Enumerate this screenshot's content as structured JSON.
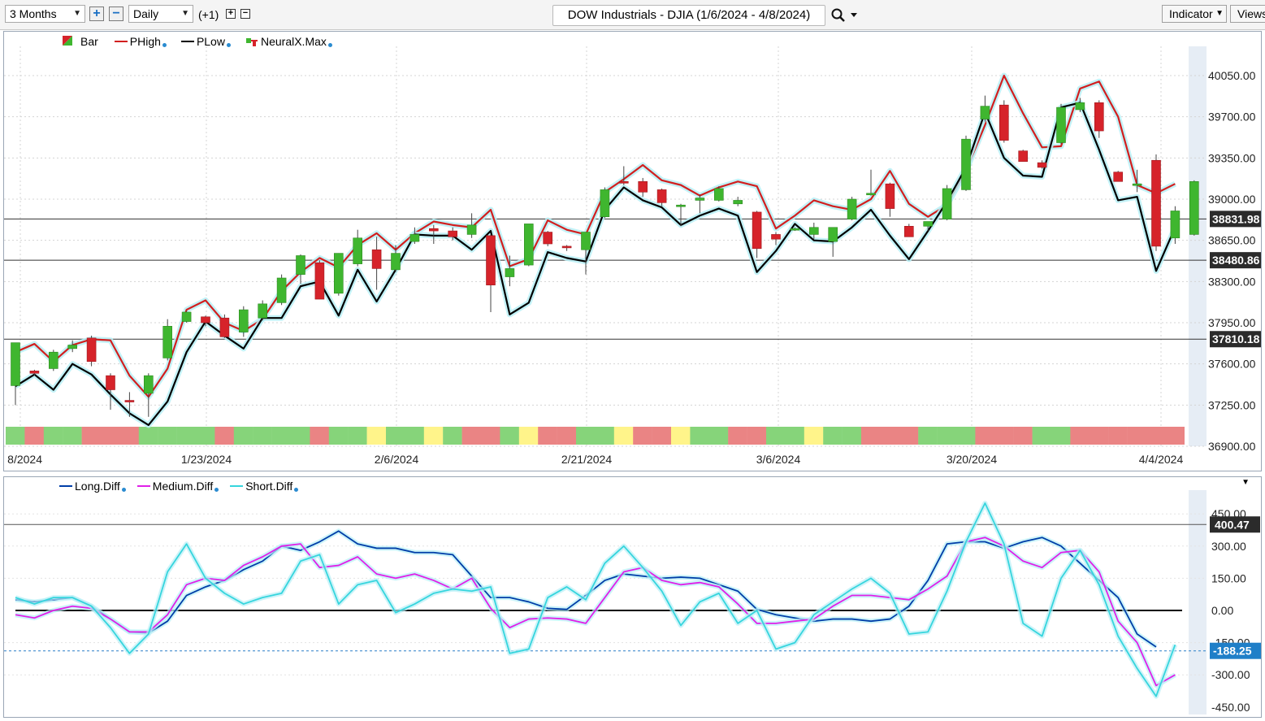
{
  "toolbar": {
    "range": "3 Months",
    "interval": "Daily",
    "offset": "(+1)",
    "title": "DOW Industrials - DJIA (1/6/2024 - 4/8/2024)",
    "indicator_btn": "Indicator",
    "views_btn": "Views"
  },
  "colors": {
    "up": "#3fb62f",
    "down": "#d6232a",
    "phigh": "#d21f1f",
    "plow": "#000000",
    "glow": "#b8f0f6",
    "long": "#003ea8",
    "medium": "#e020e8",
    "short": "#36d5dd"
  },
  "legend_top": [
    {
      "label": "Bar",
      "icon": "candle-icon"
    },
    {
      "label": "PHigh",
      "icon": "line-red-icon"
    },
    {
      "label": "PLow",
      "icon": "line-black-icon"
    },
    {
      "label": "NeuralX.Max",
      "icon": "bar-icon"
    }
  ],
  "legend_bottom": [
    {
      "label": "Long.Diff",
      "color": "#003ea8"
    },
    {
      "label": "Medium.Diff",
      "color": "#e020e8"
    },
    {
      "label": "Short.Diff",
      "color": "#36d5dd"
    }
  ],
  "chart_data": [
    {
      "type": "candlestick",
      "title": "DOW Industrials - DJIA (1/6/2024 - 4/8/2024)",
      "x_tick_labels": [
        "8/2024",
        "1/23/2024",
        "2/6/2024",
        "2/21/2024",
        "3/6/2024",
        "3/20/2024",
        "4/4/2024"
      ],
      "y_tick_labels": [
        "40050.00",
        "39700.00",
        "39350.00",
        "39000.00",
        "38650.00",
        "38300.00",
        "37950.00",
        "37600.00",
        "37250.00",
        "36900.00"
      ],
      "ylim": [
        36900,
        40350
      ],
      "hlines": [
        {
          "value": 38831.98,
          "label": "38831.98"
        },
        {
          "value": 38480.86,
          "label": "38480.86"
        },
        {
          "value": 37810.18,
          "label": "37810.18"
        }
      ],
      "candles": [
        {
          "o": 37415,
          "h": 37740,
          "l": 37250,
          "c": 37780
        },
        {
          "o": 37540,
          "h": 37550,
          "l": 37500,
          "c": 37520
        },
        {
          "o": 37560,
          "h": 37720,
          "l": 37540,
          "c": 37700
        },
        {
          "o": 37730,
          "h": 37800,
          "l": 37700,
          "c": 37760
        },
        {
          "o": 37820,
          "h": 37840,
          "l": 37580,
          "c": 37620
        },
        {
          "o": 37500,
          "h": 37520,
          "l": 37210,
          "c": 37380
        },
        {
          "o": 37290,
          "h": 37360,
          "l": 37150,
          "c": 37280
        },
        {
          "o": 37350,
          "h": 37520,
          "l": 37150,
          "c": 37500
        },
        {
          "o": 37650,
          "h": 37980,
          "l": 37630,
          "c": 37920
        },
        {
          "o": 37960,
          "h": 38050,
          "l": 37950,
          "c": 38040
        },
        {
          "o": 38000,
          "h": 38010,
          "l": 37920,
          "c": 37950
        },
        {
          "o": 37990,
          "h": 38020,
          "l": 37820,
          "c": 37830
        },
        {
          "o": 37870,
          "h": 38090,
          "l": 37830,
          "c": 38060
        },
        {
          "o": 37990,
          "h": 38140,
          "l": 37970,
          "c": 38110
        },
        {
          "o": 38120,
          "h": 38360,
          "l": 38100,
          "c": 38330
        },
        {
          "o": 38360,
          "h": 38530,
          "l": 38280,
          "c": 38520
        },
        {
          "o": 38460,
          "h": 38480,
          "l": 38150,
          "c": 38150
        },
        {
          "o": 38200,
          "h": 38540,
          "l": 38180,
          "c": 38540
        },
        {
          "o": 38450,
          "h": 38740,
          "l": 38430,
          "c": 38670
        },
        {
          "o": 38570,
          "h": 38680,
          "l": 38230,
          "c": 38410
        },
        {
          "o": 38400,
          "h": 38610,
          "l": 38380,
          "c": 38540
        },
        {
          "o": 38640,
          "h": 38760,
          "l": 38620,
          "c": 38700
        },
        {
          "o": 38750,
          "h": 38780,
          "l": 38620,
          "c": 38730
        },
        {
          "o": 38730,
          "h": 38760,
          "l": 38650,
          "c": 38680
        },
        {
          "o": 38700,
          "h": 38880,
          "l": 38670,
          "c": 38780
        },
        {
          "o": 38690,
          "h": 38700,
          "l": 38040,
          "c": 38270
        },
        {
          "o": 38340,
          "h": 38520,
          "l": 38260,
          "c": 38410
        },
        {
          "o": 38440,
          "h": 38780,
          "l": 38430,
          "c": 38790
        },
        {
          "o": 38720,
          "h": 38730,
          "l": 38600,
          "c": 38620
        },
        {
          "o": 38600,
          "h": 38610,
          "l": 38560,
          "c": 38590
        },
        {
          "o": 38570,
          "h": 38710,
          "l": 38360,
          "c": 38720
        },
        {
          "o": 38850,
          "h": 39100,
          "l": 38840,
          "c": 39080
        },
        {
          "o": 39150,
          "h": 39280,
          "l": 39120,
          "c": 39140
        },
        {
          "o": 39150,
          "h": 39180,
          "l": 39020,
          "c": 39060
        },
        {
          "o": 39080,
          "h": 39090,
          "l": 38940,
          "c": 38970
        },
        {
          "o": 38950,
          "h": 38960,
          "l": 38770,
          "c": 38950
        },
        {
          "o": 38990,
          "h": 39040,
          "l": 38880,
          "c": 39010
        },
        {
          "o": 38990,
          "h": 39110,
          "l": 38980,
          "c": 39090
        },
        {
          "o": 38960,
          "h": 39020,
          "l": 38940,
          "c": 38990
        },
        {
          "o": 38890,
          "h": 38900,
          "l": 38500,
          "c": 38580
        },
        {
          "o": 38700,
          "h": 38720,
          "l": 38610,
          "c": 38660
        },
        {
          "o": 38750,
          "h": 38760,
          "l": 38730,
          "c": 38750
        },
        {
          "o": 38700,
          "h": 38800,
          "l": 38660,
          "c": 38760
        },
        {
          "o": 38640,
          "h": 38760,
          "l": 38510,
          "c": 38760
        },
        {
          "o": 38830,
          "h": 39020,
          "l": 38820,
          "c": 39000
        },
        {
          "o": 39050,
          "h": 39250,
          "l": 39030,
          "c": 39050
        },
        {
          "o": 39130,
          "h": 39140,
          "l": 38850,
          "c": 38920
        },
        {
          "o": 38770,
          "h": 38790,
          "l": 38680,
          "c": 38680
        },
        {
          "o": 38770,
          "h": 38810,
          "l": 38730,
          "c": 38810
        },
        {
          "o": 38830,
          "h": 39120,
          "l": 38820,
          "c": 39090
        },
        {
          "o": 39080,
          "h": 39540,
          "l": 39070,
          "c": 39510
        },
        {
          "o": 39680,
          "h": 39880,
          "l": 39660,
          "c": 39790
        },
        {
          "o": 39800,
          "h": 39840,
          "l": 39480,
          "c": 39500
        },
        {
          "o": 39410,
          "h": 39420,
          "l": 39320,
          "c": 39320
        },
        {
          "o": 39310,
          "h": 39330,
          "l": 39260,
          "c": 39270
        },
        {
          "o": 39480,
          "h": 39810,
          "l": 39470,
          "c": 39780
        },
        {
          "o": 39760,
          "h": 39860,
          "l": 39740,
          "c": 39820
        },
        {
          "o": 39820,
          "h": 39840,
          "l": 39520,
          "c": 39580
        },
        {
          "o": 39230,
          "h": 39240,
          "l": 39150,
          "c": 39150
        },
        {
          "o": 39130,
          "h": 39250,
          "l": 39060,
          "c": 39130
        },
        {
          "o": 39330,
          "h": 39380,
          "l": 38560,
          "c": 38600
        },
        {
          "o": 38670,
          "h": 38940,
          "l": 38620,
          "c": 38900
        },
        {
          "o": 38700,
          "h": 39160,
          "l": 38690,
          "c": 39150
        }
      ],
      "phigh": [
        37700,
        37770,
        37620,
        37760,
        37810,
        37800,
        37500,
        37320,
        37560,
        38060,
        38140,
        37950,
        37880,
        37980,
        38220,
        38380,
        38500,
        38420,
        38610,
        38710,
        38570,
        38710,
        38810,
        38780,
        38760,
        38910,
        38430,
        38490,
        38820,
        38740,
        38700,
        39060,
        39170,
        39290,
        39160,
        39120,
        39030,
        39100,
        39150,
        39110,
        38750,
        38860,
        38990,
        38940,
        38910,
        39000,
        39240,
        38960,
        38850,
        38950,
        39240,
        39630,
        40050,
        39730,
        39440,
        39450,
        39940,
        40000,
        39700,
        39120,
        39050,
        39130
      ],
      "plow": [
        37410,
        37510,
        37380,
        37600,
        37510,
        37340,
        37180,
        37080,
        37280,
        37700,
        37960,
        37840,
        37730,
        37990,
        37990,
        38260,
        38300,
        38010,
        38400,
        38130,
        38400,
        38700,
        38690,
        38690,
        38570,
        38730,
        38020,
        38120,
        38550,
        38500,
        38470,
        38910,
        39100,
        38990,
        38930,
        38780,
        38860,
        38920,
        38860,
        38380,
        38560,
        38790,
        38650,
        38640,
        38760,
        38910,
        38690,
        38490,
        38730,
        38980,
        39270,
        39740,
        39350,
        39200,
        39190,
        39780,
        39820,
        39420,
        38990,
        39020,
        38390,
        38760
      ]
    },
    {
      "type": "line",
      "y_tick_labels": [
        "450.00",
        "300.00",
        "150.00",
        "0.00",
        "-150.00",
        "-300.00",
        "-450.00"
      ],
      "ylim": [
        -480,
        480
      ],
      "hlines": [
        {
          "value": 400.47,
          "label": "400.47"
        },
        {
          "value": 0,
          "label": ""
        },
        {
          "value": -188.25,
          "label": "-188.25"
        }
      ],
      "series": [
        {
          "name": "Long.Diff",
          "values": [
            50,
            40,
            50,
            60,
            20,
            -40,
            -100,
            -105,
            -50,
            70,
            110,
            140,
            190,
            230,
            300,
            280,
            320,
            370,
            310,
            290,
            290,
            270,
            270,
            260,
            160,
            60,
            60,
            40,
            10,
            5,
            70,
            140,
            170,
            160,
            150,
            155,
            150,
            120,
            90,
            5,
            -20,
            -35,
            -50,
            -40,
            -40,
            -50,
            -40,
            20,
            140,
            310,
            320,
            320,
            290,
            320,
            340,
            300,
            220,
            140,
            60,
            -110,
            -170
          ]
        },
        {
          "name": "Medium.Diff",
          "values": [
            -20,
            -35,
            0,
            20,
            10,
            -40,
            -100,
            -100,
            -20,
            120,
            150,
            140,
            210,
            250,
            300,
            310,
            200,
            210,
            250,
            170,
            150,
            170,
            140,
            100,
            150,
            10,
            -80,
            -40,
            -35,
            -40,
            -60,
            60,
            180,
            200,
            140,
            120,
            130,
            110,
            30,
            -60,
            -60,
            -50,
            -40,
            20,
            70,
            70,
            60,
            50,
            100,
            160,
            320,
            340,
            300,
            230,
            200,
            270,
            280,
            180,
            -50,
            -150,
            -350,
            -300
          ]
        },
        {
          "name": "Short.Diff",
          "values": [
            60,
            30,
            60,
            60,
            20,
            -80,
            -200,
            -110,
            180,
            310,
            150,
            80,
            30,
            60,
            80,
            230,
            260,
            30,
            120,
            140,
            -10,
            30,
            80,
            100,
            90,
            110,
            -200,
            -180,
            60,
            110,
            50,
            220,
            300,
            200,
            90,
            -70,
            40,
            80,
            -60,
            0,
            -180,
            -150,
            -20,
            40,
            100,
            150,
            80,
            -110,
            -100,
            90,
            320,
            500,
            310,
            -60,
            -120,
            150,
            280,
            120,
            -120,
            -270,
            -400,
            -160
          ]
        }
      ]
    }
  ],
  "bottom_right_arrow": "chevron-down-icon"
}
